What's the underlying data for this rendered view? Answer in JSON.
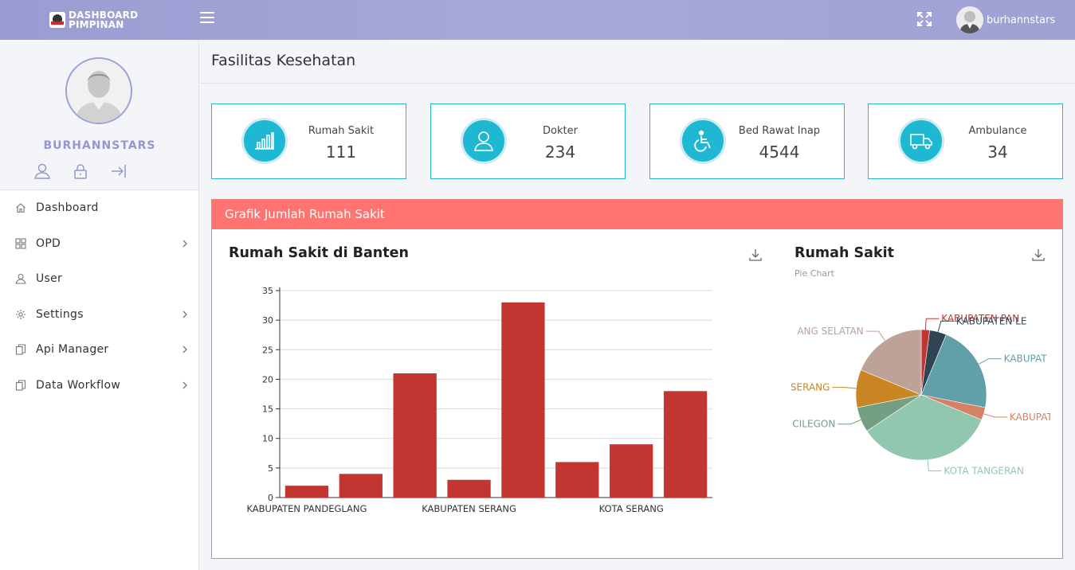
{
  "header": {
    "brand_line1": "DASHBOARD",
    "brand_line2": "PIMPINAN",
    "username": "burhannstars"
  },
  "sidebar": {
    "username": "BURHANNSTARS",
    "items": [
      {
        "label": "Dashboard",
        "icon": "home-icon",
        "has_children": false
      },
      {
        "label": "OPD",
        "icon": "grid-icon",
        "has_children": true
      },
      {
        "label": "User",
        "icon": "user-icon",
        "has_children": false
      },
      {
        "label": "Settings",
        "icon": "gear-icon",
        "has_children": true
      },
      {
        "label": "Api Manager",
        "icon": "copy-icon",
        "has_children": true
      },
      {
        "label": "Data Workflow",
        "icon": "copy-icon",
        "has_children": true
      }
    ]
  },
  "page": {
    "title": "Fasilitas Kesehatan"
  },
  "stats": [
    {
      "label": "Rumah Sakit",
      "value": "111",
      "icon": "bar-chart-icon"
    },
    {
      "label": "Dokter",
      "value": "234",
      "icon": "user-icon"
    },
    {
      "label": "Bed Rawat Inap",
      "value": "4544",
      "icon": "wheelchair-icon"
    },
    {
      "label": "Ambulance",
      "value": "34",
      "icon": "truck-icon"
    }
  ],
  "panel": {
    "title": "Grafik Jumlah Rumah Sakit"
  },
  "colors": {
    "topbar": "#9fa1d4",
    "accent": "#1eb8d3",
    "panel_header": "#ff7471",
    "bar": "#c23531"
  },
  "chart_data": [
    {
      "type": "bar",
      "title": "Rumah Sakit di Banten",
      "categories": [
        "KABUPATEN PANDEGLANG",
        "KABUPATEN LEBAK",
        "KABUPATEN TANGERANG",
        "KABUPATEN SERANG",
        "KOTA TANGERANG",
        "KOTA CILEGON",
        "KOTA SERANG",
        "KOTA TANGERANG SELATAN"
      ],
      "visible_tick_labels": [
        "KABUPATEN PANDEGLANG",
        "KABUPATEN SERANG",
        "KOTA SERANG"
      ],
      "values": [
        2,
        4,
        21,
        3,
        33,
        6,
        9,
        18
      ],
      "ylim": [
        0,
        35
      ],
      "yticks": [
        0,
        5,
        10,
        15,
        20,
        25,
        30,
        35
      ],
      "grid": true
    },
    {
      "type": "pie",
      "title": "Rumah Sakit",
      "subtitle": "Pie Chart",
      "slices": [
        {
          "label": "KABUPATEN PAN",
          "value": 2,
          "color": "#c23531"
        },
        {
          "label": "KABUPATEN LE",
          "value": 4,
          "color": "#2f4554"
        },
        {
          "label": "KABUPAT",
          "value": 21,
          "color": "#61a0a8"
        },
        {
          "label": "KABUPAT",
          "value": 3,
          "color": "#d48265"
        },
        {
          "label": "KOTA TANGERAN",
          "value": 33,
          "color": "#91c7ae"
        },
        {
          "label": "CILEGON",
          "value": 6,
          "color": "#749f83"
        },
        {
          "label": "SERANG",
          "value": 9,
          "color": "#ca8622"
        },
        {
          "label": "ANG SELATAN",
          "value": 18,
          "color": "#bda29a"
        }
      ]
    }
  ]
}
